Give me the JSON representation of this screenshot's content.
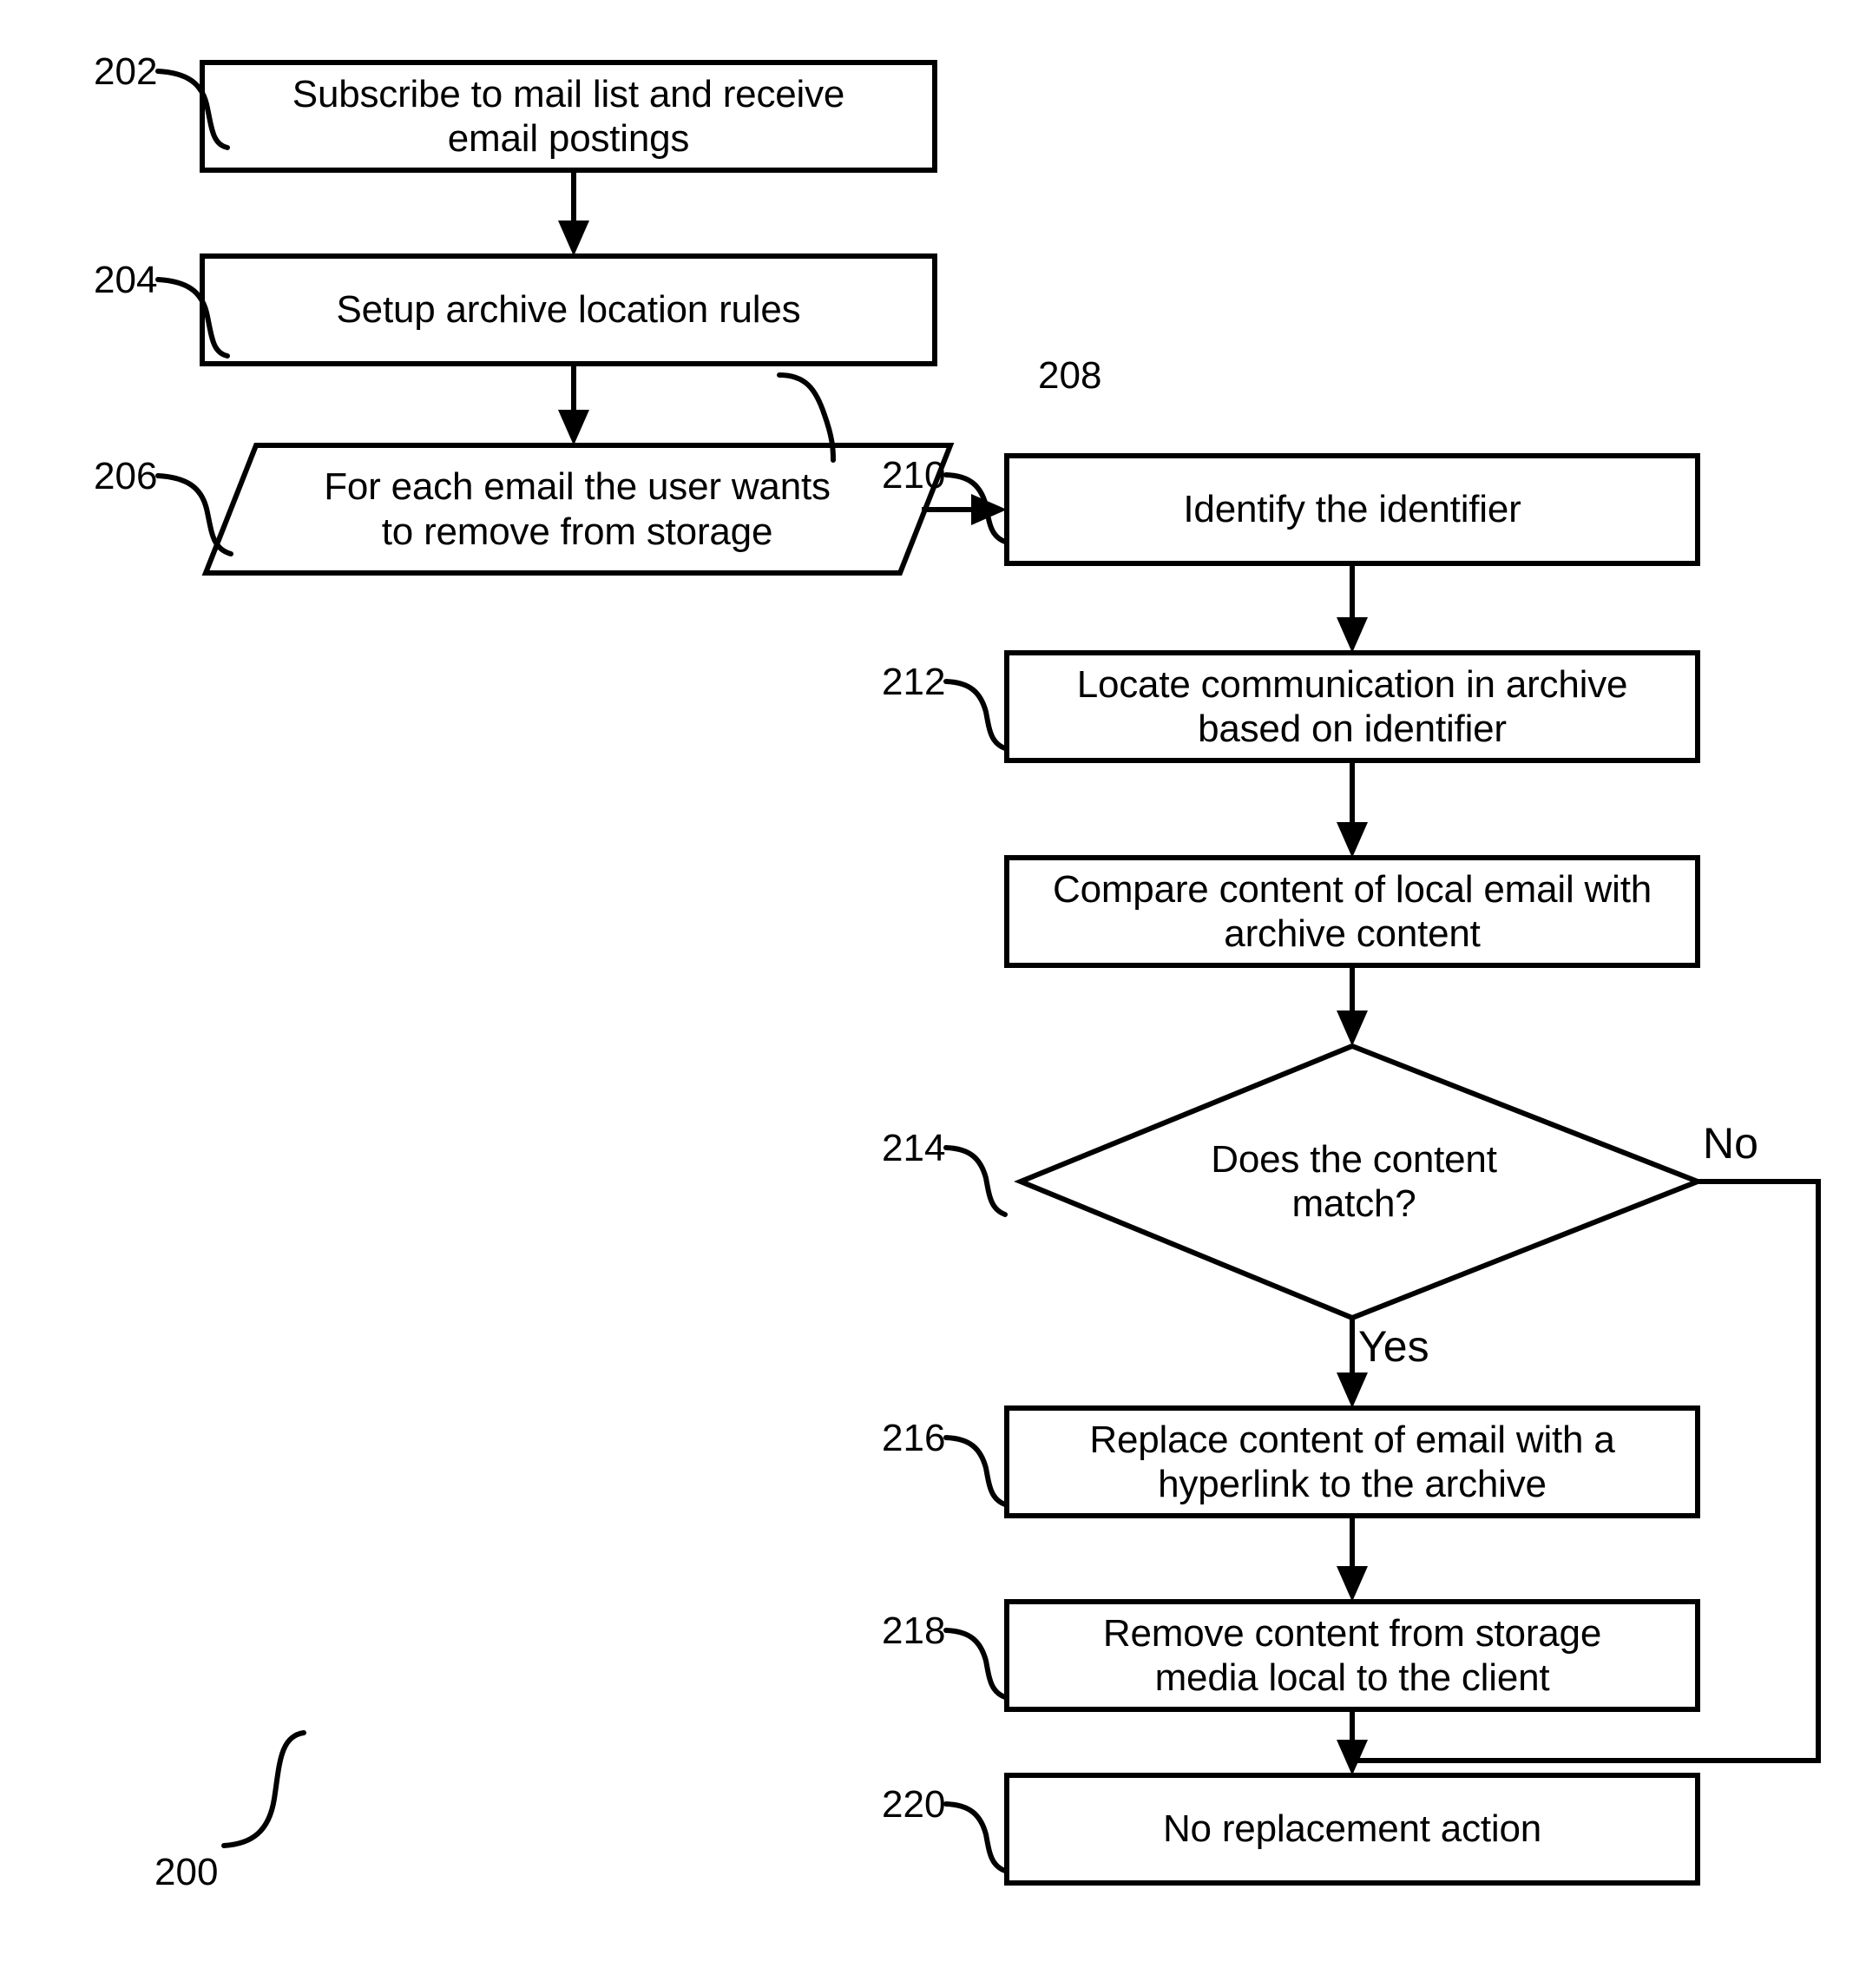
{
  "figure": {
    "figure_ref": "200",
    "nodes": [
      {
        "ref": "202",
        "shape": "process",
        "text": "Subscribe to mail list and receive\nemail postings"
      },
      {
        "ref": "204",
        "shape": "process",
        "text": "Setup archive location rules"
      },
      {
        "ref": "206",
        "shape": "parallelogram",
        "text": "For each email the user wants\nto remove from storage"
      },
      {
        "ref": "208",
        "shape": "process",
        "text": "Identify the identifier"
      },
      {
        "ref": "210",
        "shape": "process",
        "text": "Locate communication in archive\nbased on identifier"
      },
      {
        "ref": "212",
        "shape": "process",
        "text": "Compare content of local email with\narchive content"
      },
      {
        "ref": "214",
        "shape": "decision",
        "text": "Does the content\nmatch?"
      },
      {
        "ref": "216",
        "shape": "process",
        "text": "Replace content of email with a\nhyperlink to the archive"
      },
      {
        "ref": "218",
        "shape": "process",
        "text": "Remove content from storage\nmedia local to the client"
      },
      {
        "ref": "220",
        "shape": "process",
        "text": "No replacement action"
      }
    ],
    "branch_labels": {
      "yes": "Yes",
      "no": "No"
    },
    "colors": {
      "stroke": "#000000",
      "fill": "#ffffff",
      "text": "#000000"
    }
  }
}
